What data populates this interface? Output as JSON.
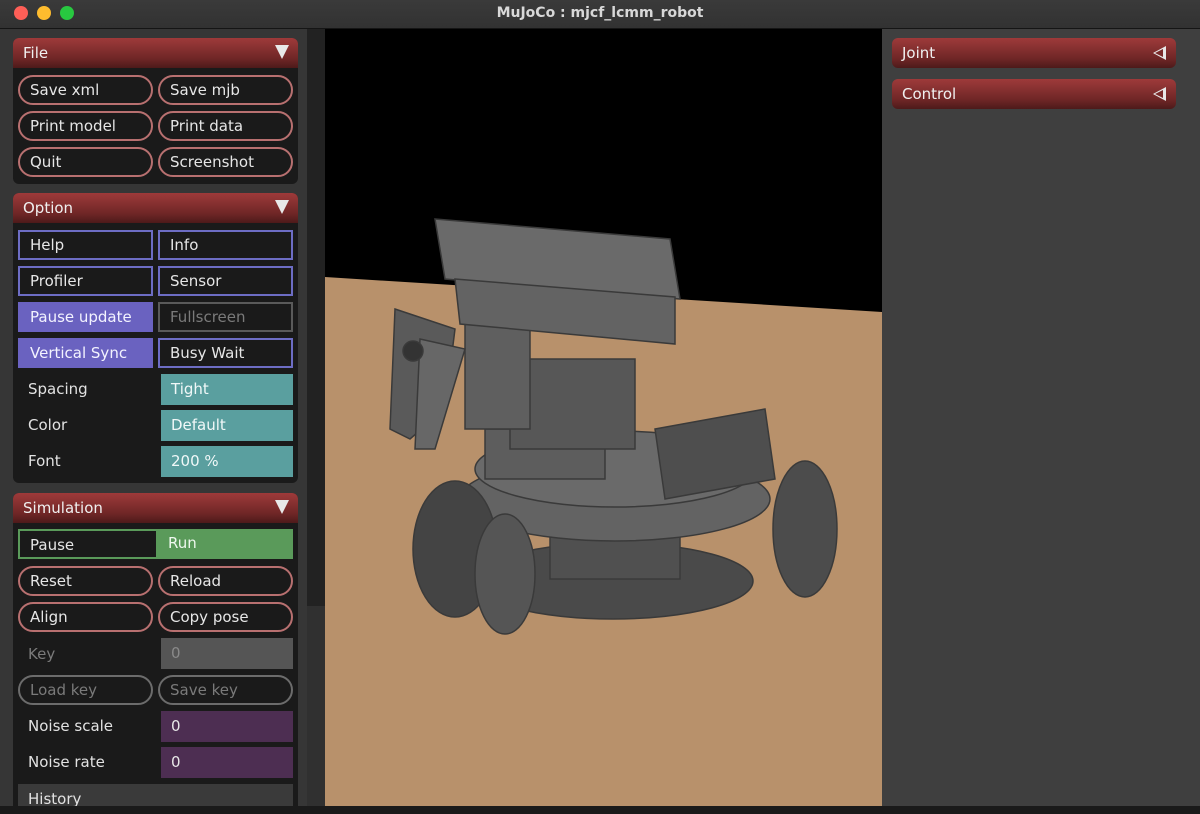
{
  "window": {
    "title": "MuJoCo : mjcf_lcmm_robot"
  },
  "colors": {
    "header": "#8b3030",
    "teal": "#5a9f9f",
    "active": "#6a62c0",
    "run": "#5a9a5a",
    "floor": "#b8916b"
  },
  "file": {
    "title": "File",
    "save_xml": "Save xml",
    "save_mjb": "Save mjb",
    "print_model": "Print model",
    "print_data": "Print data",
    "quit": "Quit",
    "screenshot": "Screenshot"
  },
  "option": {
    "title": "Option",
    "help": "Help",
    "info": "Info",
    "profiler": "Profiler",
    "sensor": "Sensor",
    "pause_update": "Pause update",
    "fullscreen": "Fullscreen",
    "vertical_sync": "Vertical Sync",
    "busy_wait": "Busy Wait",
    "spacing_label": "Spacing",
    "spacing_value": "Tight",
    "color_label": "Color",
    "color_value": "Default",
    "font_label": "Font",
    "font_value": "200 %"
  },
  "simulation": {
    "title": "Simulation",
    "pause": "Pause",
    "run": "Run",
    "reset": "Reset",
    "reload": "Reload",
    "align": "Align",
    "copy_pose": "Copy pose",
    "key_label": "Key",
    "key_value": "0",
    "load_key": "Load key",
    "save_key": "Save key",
    "noise_scale_label": "Noise scale",
    "noise_scale_value": "0",
    "noise_rate_label": "Noise rate",
    "noise_rate_value": "0",
    "history_label": "History"
  },
  "right_panel": {
    "joint": "Joint",
    "control": "Control"
  }
}
